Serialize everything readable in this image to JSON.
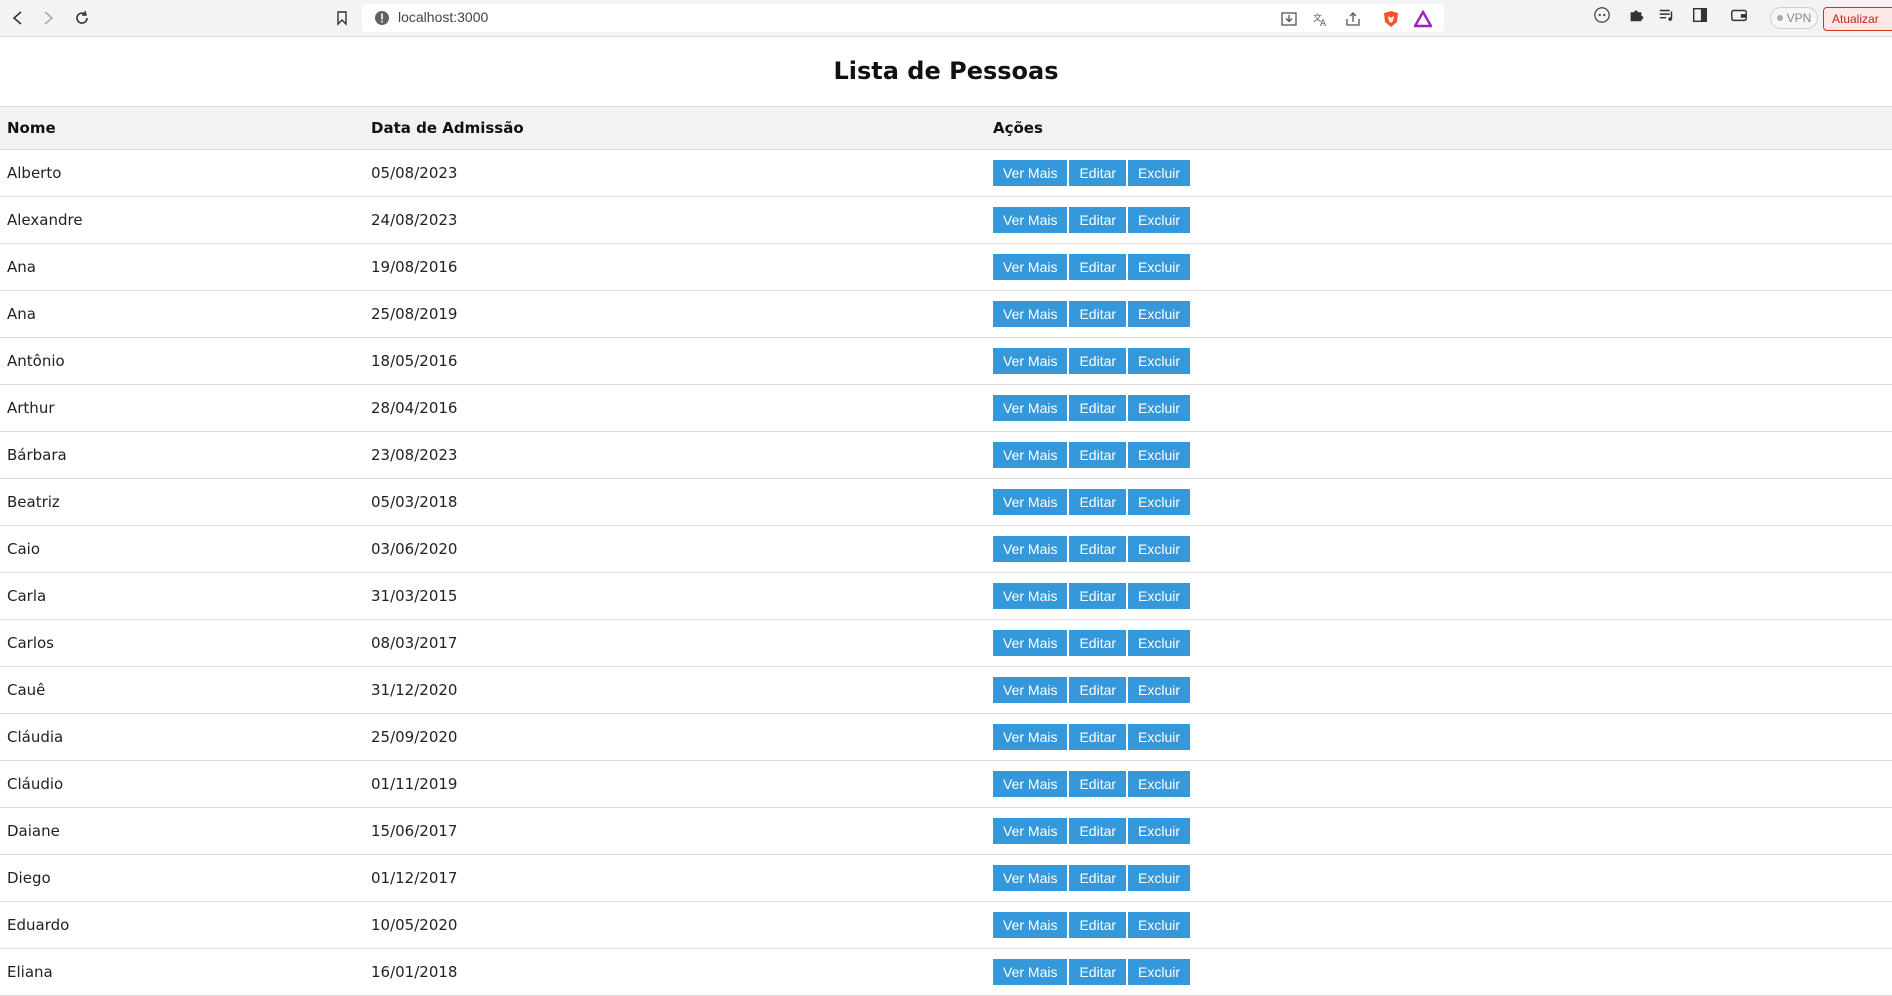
{
  "browser": {
    "url": "localhost:3000",
    "vpn_label": "VPN",
    "update_label": "Atualizar"
  },
  "page": {
    "title": "Lista de Pessoas"
  },
  "table": {
    "headers": [
      "Nome",
      "Data de Admissão",
      "Ações"
    ],
    "actions": {
      "view": "Ver Mais",
      "edit": "Editar",
      "delete": "Excluir"
    },
    "rows": [
      {
        "name": "Alberto",
        "date": "05/08/2023"
      },
      {
        "name": "Alexandre",
        "date": "24/08/2023"
      },
      {
        "name": "Ana",
        "date": "19/08/2016"
      },
      {
        "name": "Ana",
        "date": "25/08/2019"
      },
      {
        "name": "Antônio",
        "date": "18/05/2016"
      },
      {
        "name": "Arthur",
        "date": "28/04/2016"
      },
      {
        "name": "Bárbara",
        "date": "23/08/2023"
      },
      {
        "name": "Beatriz",
        "date": "05/03/2018"
      },
      {
        "name": "Caio",
        "date": "03/06/2020"
      },
      {
        "name": "Carla",
        "date": "31/03/2015"
      },
      {
        "name": "Carlos",
        "date": "08/03/2017"
      },
      {
        "name": "Cauê",
        "date": "31/12/2020"
      },
      {
        "name": "Cláudia",
        "date": "25/09/2020"
      },
      {
        "name": "Cláudio",
        "date": "01/11/2019"
      },
      {
        "name": "Daiane",
        "date": "15/06/2017"
      },
      {
        "name": "Diego",
        "date": "01/12/2017"
      },
      {
        "name": "Eduardo",
        "date": "10/05/2020"
      },
      {
        "name": "Eliana",
        "date": "16/01/2018"
      }
    ]
  },
  "colors": {
    "button": "#3498db",
    "header_bg": "#f2f2f2"
  }
}
